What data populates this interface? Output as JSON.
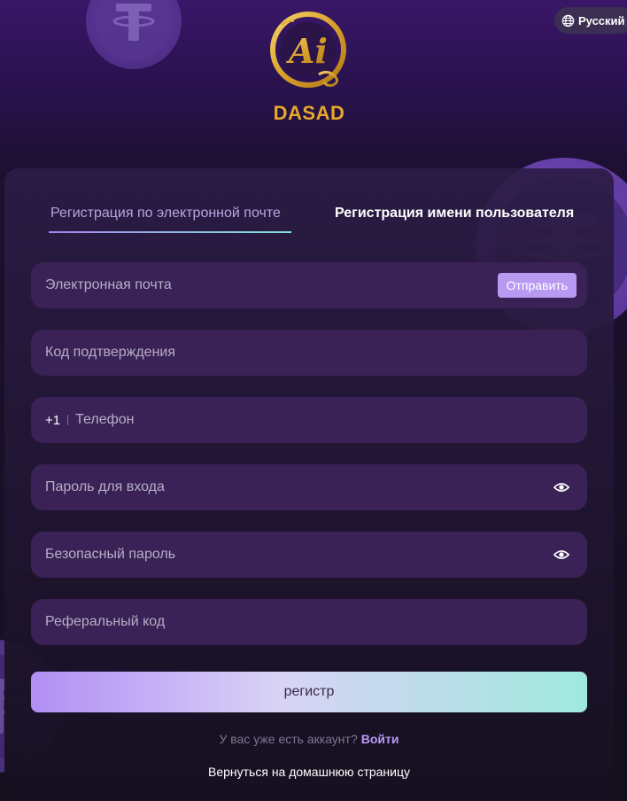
{
  "language": {
    "label": "Русский",
    "icon": "globe-icon"
  },
  "brand": {
    "name": "DASAD",
    "logo_text": "Ai",
    "logo_color": "#e8a82c"
  },
  "tabs": [
    {
      "label": "Регистрация по электронной почте",
      "active": true
    },
    {
      "label": "Регистрация имени пользователя",
      "active": false
    }
  ],
  "form": {
    "email": {
      "placeholder": "Электронная почта",
      "send_label": "Отправить"
    },
    "verification_code": {
      "placeholder": "Код подтверждения"
    },
    "phone": {
      "country_code": "+1",
      "placeholder": "Телефон"
    },
    "login_password": {
      "placeholder": "Пароль для входа",
      "icon": "eye-icon"
    },
    "security_password": {
      "placeholder": "Безопасный пароль",
      "icon": "eye-icon"
    },
    "referral_code": {
      "placeholder": "Реферальный код"
    },
    "submit_label": "регистр"
  },
  "footer": {
    "have_account": "У вас уже есть аккаунт?",
    "login_link": "Войти",
    "home_link": "Вернуться на домашнюю страницу"
  },
  "colors": {
    "accent": "#b89af2",
    "gold": "#e8a82c",
    "field_bg": "#3a2256",
    "teal": "#7fe6d8"
  }
}
